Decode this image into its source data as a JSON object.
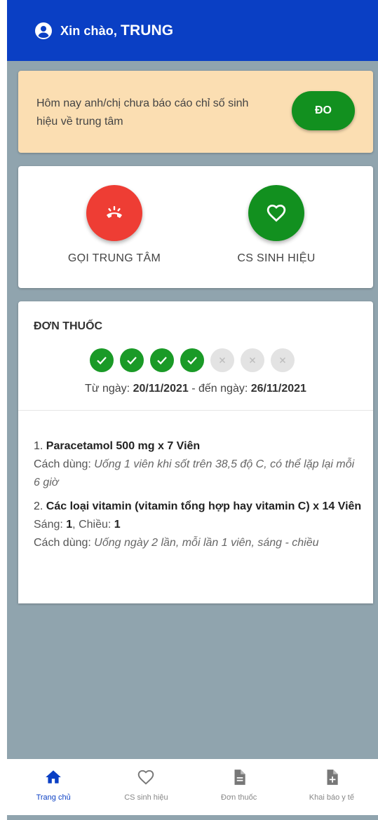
{
  "header": {
    "greeting": "Xin chào,",
    "name": "TRUNG"
  },
  "alert": {
    "message": "Hôm nay anh/chị chưa báo cáo chỉ số sinh hiệu về trung tâm",
    "button_label": "ĐO"
  },
  "actions": {
    "call_label": "GỌI TRUNG TÂM",
    "vitals_label": "CS SINH HIỆU"
  },
  "prescription": {
    "title": "ĐƠN THUỐC",
    "progress": {
      "done": 4,
      "total": 7
    },
    "from_label": "Từ ngày:",
    "from_date": "20/11/2021",
    "to_label": "- đến ngày:",
    "to_date": "26/11/2021",
    "meds": [
      {
        "index": "1.",
        "name": "Paracetamol 500 mg x 7 Viên",
        "usage_label": "Cách dùng:",
        "usage": "Uống 1 viên khi sốt trên 38,5 độ C, có thể lặp lại mỗi 6 giờ"
      },
      {
        "index": "2.",
        "name": "Các loại vitamin (vitamin tổng hợp hay vitamin C) x 14 Viên",
        "morning_label": "Sáng:",
        "morning": "1",
        "afternoon_label": "Chiều:",
        "afternoon": "1",
        "usage_label": "Cách dùng:",
        "usage": "Uống ngày 2 lần, mỗi lần 1 viên, sáng - chiều"
      }
    ]
  },
  "nav": [
    {
      "label": "Trang chủ",
      "icon": "home-icon",
      "active": true
    },
    {
      "label": "CS sinh hiệu",
      "icon": "heart-icon",
      "active": false
    },
    {
      "label": "Đơn thuốc",
      "icon": "document-icon",
      "active": false
    },
    {
      "label": "Khai báo y tế",
      "icon": "document-add-icon",
      "active": false
    }
  ],
  "colors": {
    "primary": "#0a3fc4",
    "success": "#12901f",
    "danger": "#ee3d34",
    "alert_bg": "#fbdeb2",
    "background": "#90a4ae"
  }
}
